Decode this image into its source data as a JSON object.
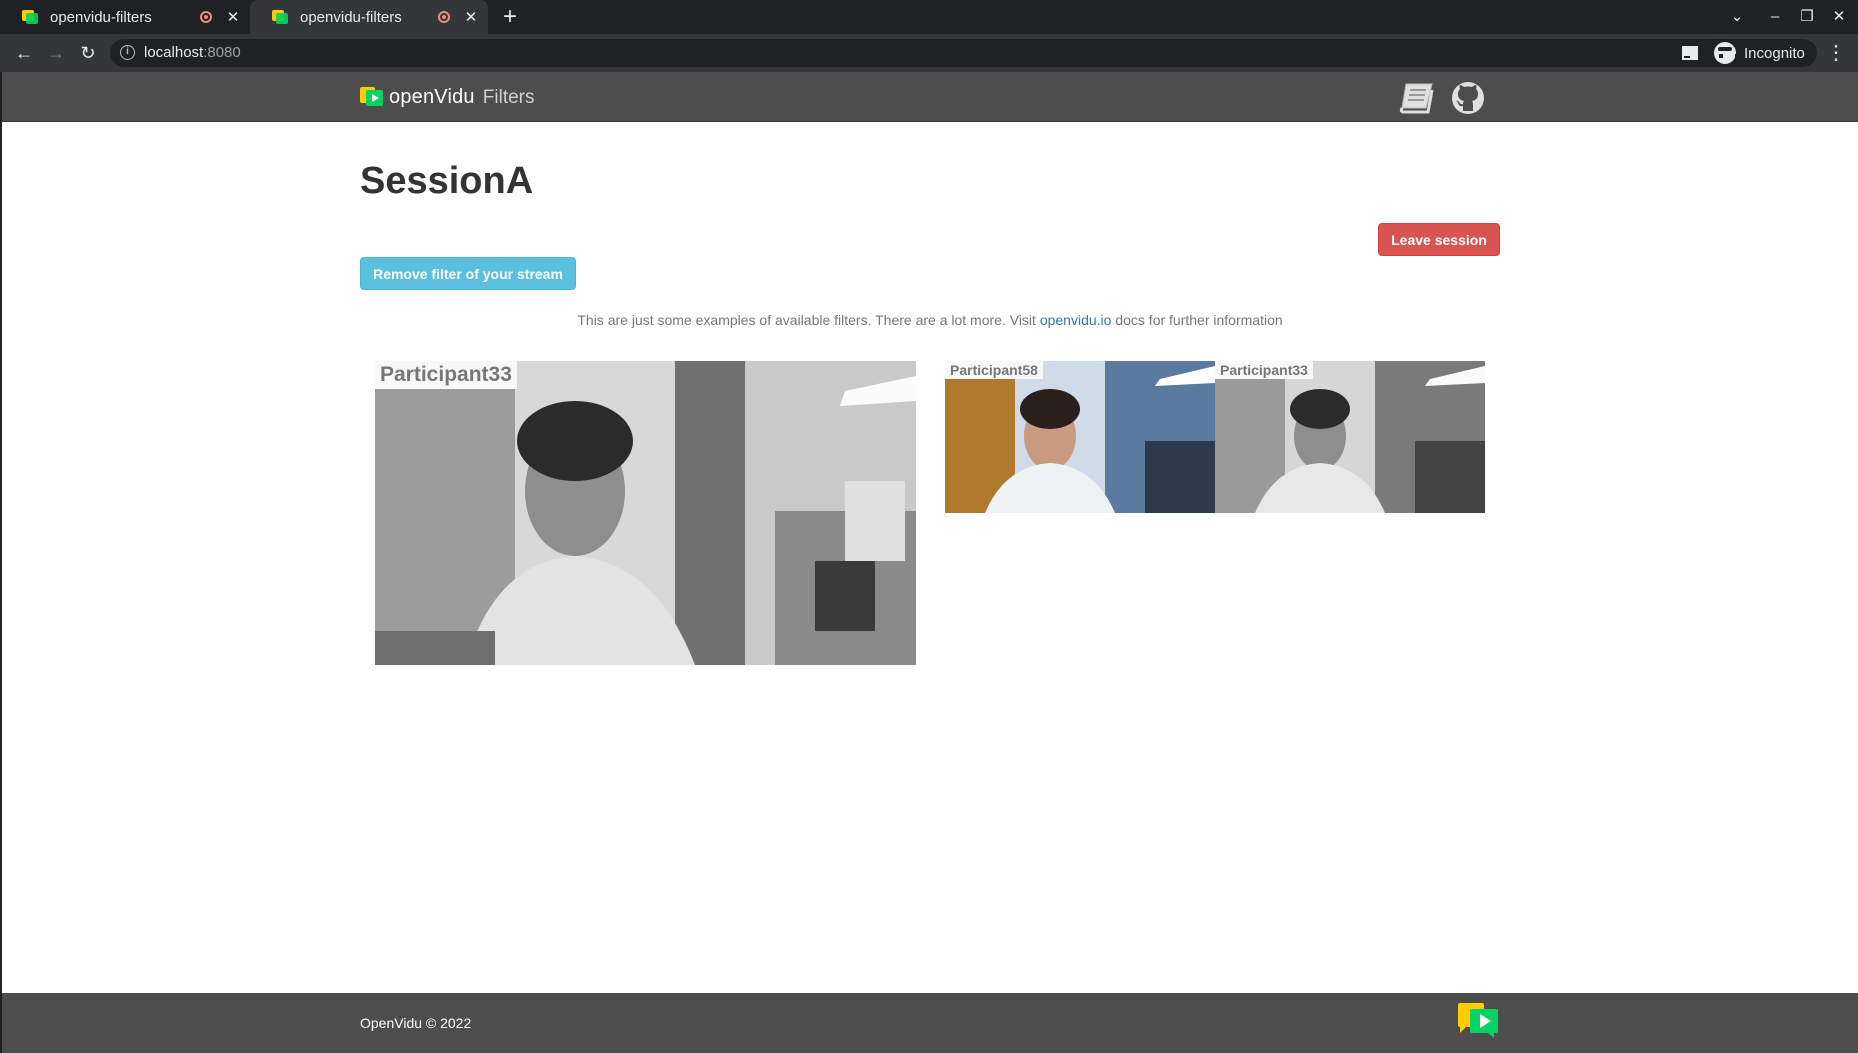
{
  "browser": {
    "tabs": [
      {
        "title": "openvidu-filters",
        "active": false
      },
      {
        "title": "openvidu-filters",
        "active": true
      }
    ],
    "new_tab": "+",
    "url_host": "localhost",
    "url_port": ":8080",
    "profile": "Incognito",
    "window_controls": {
      "list": "⌄",
      "minimize": "–",
      "restore": "❐",
      "close": "✕"
    },
    "icons": {
      "back": "←",
      "forward": "→",
      "reload": "↻",
      "star": "☆",
      "menu": "⋮",
      "tab_close": "✕"
    }
  },
  "navbar": {
    "brand_name": "openVidu",
    "brand_suffix": "Filters"
  },
  "session": {
    "title": "SessionA",
    "leave_label": "Leave session",
    "filter_label": "Remove filter of your stream"
  },
  "hint": {
    "before": "This are just some examples of available filters. There are a lot more. Visit ",
    "link": "openvidu.io",
    "after": " docs for further information"
  },
  "videos": {
    "main": {
      "participant": "Participant33",
      "filter": "grayscale"
    },
    "thumbnails": [
      {
        "participant": "Participant58",
        "filter": "none"
      },
      {
        "participant": "Participant33",
        "filter": "grayscale"
      }
    ]
  },
  "footer": {
    "copyright": "OpenVidu © 2022"
  },
  "colors": {
    "navbar": "#4d4d4d",
    "leave_button": "#d9534f",
    "filter_button": "#5bc0de",
    "link": "#337ab7",
    "logo_yellow": "#ffcc00",
    "logo_green": "#06d362"
  }
}
